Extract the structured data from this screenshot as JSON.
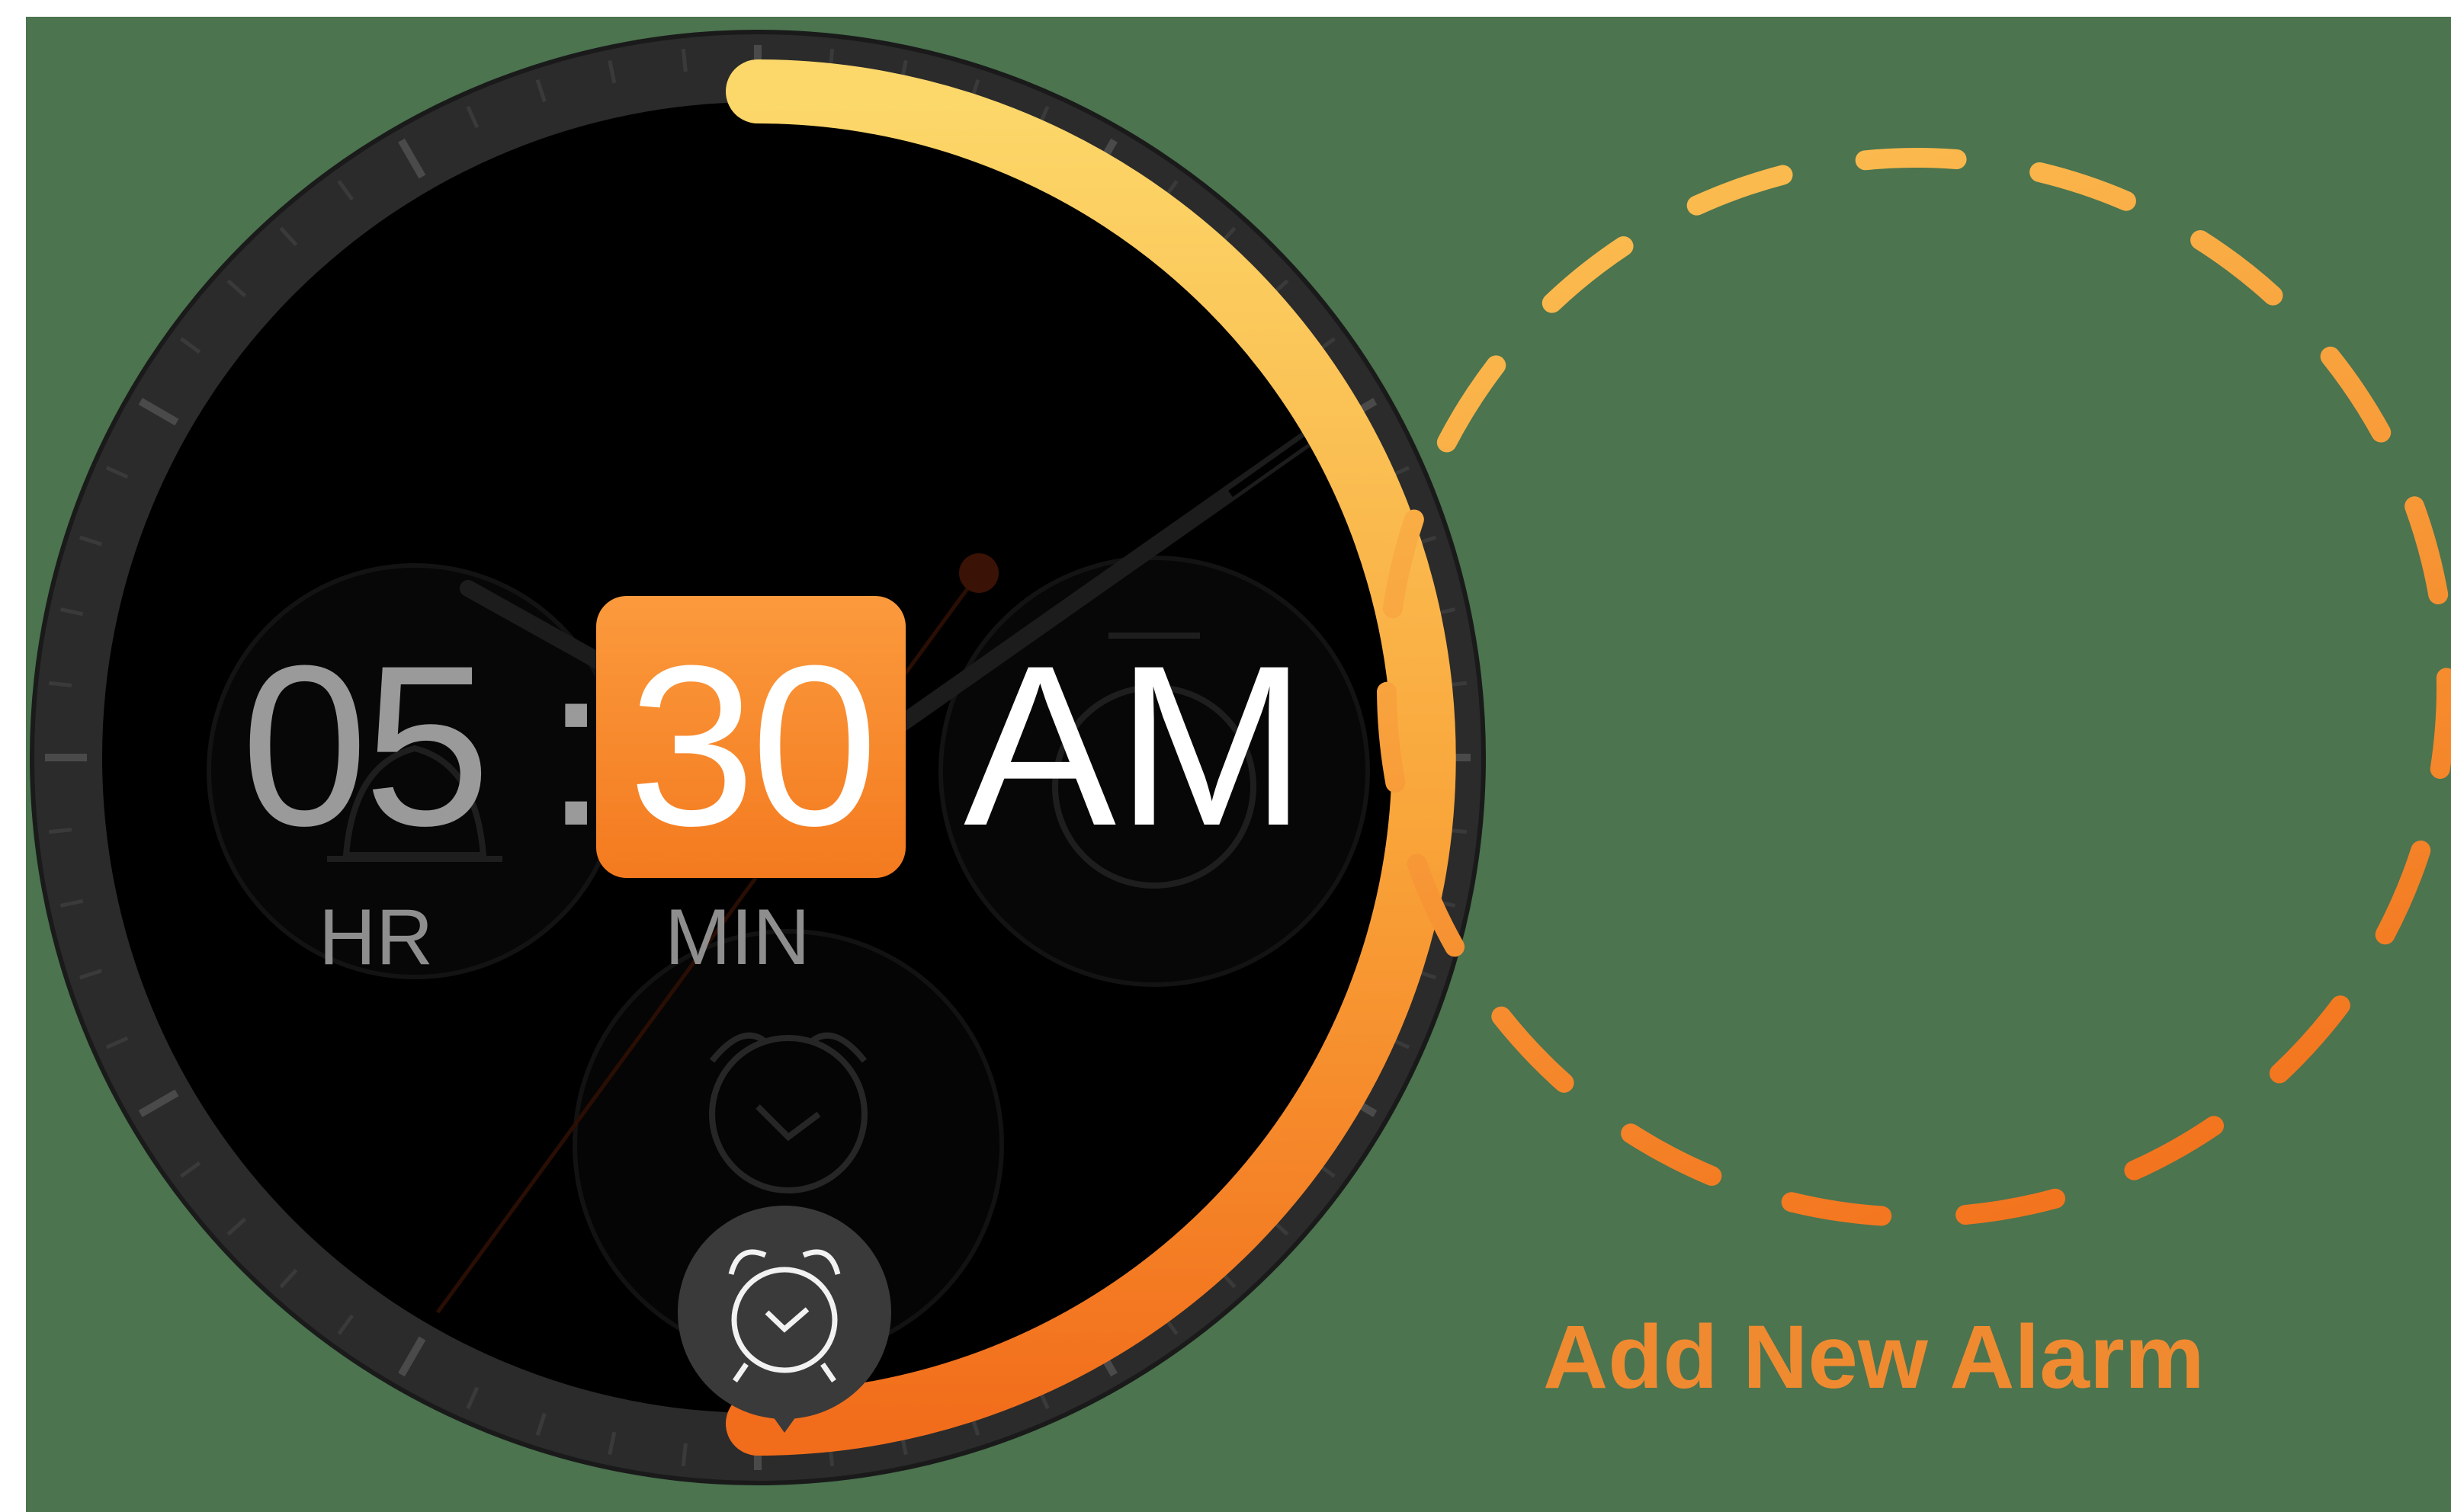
{
  "alarm": {
    "hours": "05",
    "separator": ":",
    "minutes": "30",
    "period": "AM",
    "hours_label": "HR",
    "minutes_label": "MIN",
    "progress_fraction": 0.5
  },
  "add_alarm": {
    "label": "Add New Alarm"
  },
  "icons": {
    "bell": "bell-icon",
    "stopwatch": "stopwatch-icon",
    "clock": "alarm-clock-icon",
    "selected": "alarm-clock-icon",
    "add": "plus-icon"
  },
  "colors": {
    "background": "#4b744f",
    "dial": "#000000",
    "bezel": "#2a2a2a",
    "accent_start": "#fcd86a",
    "accent_end": "#f26d1b",
    "minutes_box": "#f7892c",
    "label_orange": "#f08a30"
  }
}
